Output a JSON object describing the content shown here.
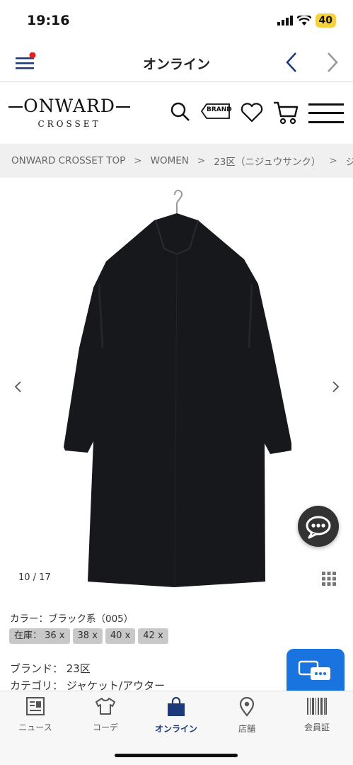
{
  "status": {
    "time": "19:16",
    "battery": "40"
  },
  "app_header": {
    "title": "オンライン"
  },
  "site": {
    "logo_main": "ONWARD",
    "logo_sub": "CROSSET",
    "brand_button": "BRAND"
  },
  "breadcrumb": [
    "ONWARD CROSSET TOP",
    "WOMEN",
    "23区（ニジュウサンク）",
    "ジャケ"
  ],
  "gallery": {
    "counter": "10 / 17"
  },
  "product": {
    "color": "カラー：ブラック系（005）",
    "sizes": [
      "在庫： 36 x",
      "38 x",
      "40 x",
      "42 x"
    ],
    "brand": "ブランド： 23区",
    "category": "カテゴリ： ジャケット/アウター"
  },
  "tabs": [
    {
      "label": "ニュース",
      "icon": "news-icon"
    },
    {
      "label": "コーデ",
      "icon": "tshirt-icon"
    },
    {
      "label": "オンライン",
      "icon": "shopping-bag-icon"
    },
    {
      "label": "店舗",
      "icon": "map-pin-icon"
    },
    {
      "label": "会員証",
      "icon": "barcode-icon"
    }
  ],
  "colors": {
    "accent": "#1c3a7a",
    "feedback": "#1a74e0",
    "battery": "#f5d13b",
    "notify": "#e02020"
  }
}
